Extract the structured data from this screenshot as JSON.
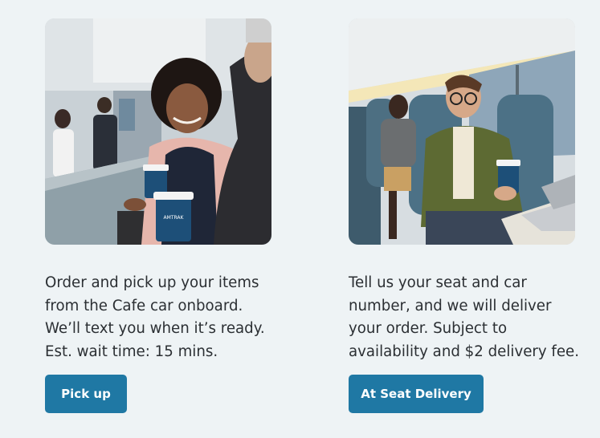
{
  "pickup": {
    "image_alt": "Passenger smiling at the Cafe car counter holding coffee cups",
    "description_lines": [
      "Order and pick up your items",
      "from the Cafe car onboard.",
      "We’ll text you when it’s ready.",
      "Est. wait time: 15 mins."
    ],
    "button_label": "Pick up"
  },
  "seat": {
    "image_alt": "Passenger seated on train holding a coffee cup next to a laptop",
    "description_lines": [
      "Tell us your seat and car",
      "number, and we will deliver",
      "your order. Subject to",
      "availability and $2 delivery fee."
    ],
    "button_label": "At Seat Delivery"
  },
  "colors": {
    "background": "#eef3f5",
    "button": "#1f78a4",
    "text": "#2b2f33"
  }
}
